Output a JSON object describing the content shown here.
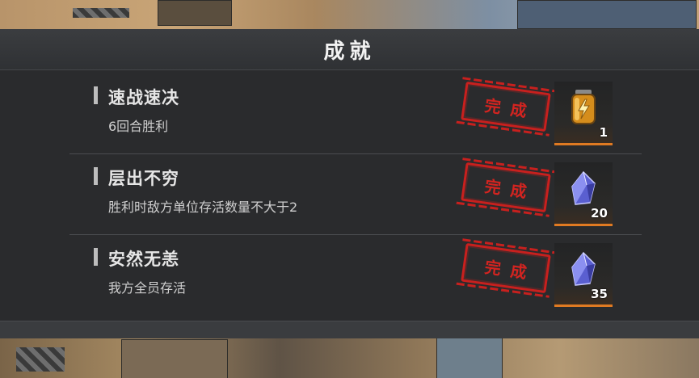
{
  "title": "成就",
  "achievements": [
    {
      "name": "速战速决",
      "description": "6回合胜利",
      "status": "完成",
      "reward_count": "1",
      "reward_icon": "energy-cell-icon"
    },
    {
      "name": "层出不穷",
      "description": "胜利时敌方单位存活数量不大于2",
      "status": "完成",
      "reward_count": "20",
      "reward_icon": "crystal-icon"
    },
    {
      "name": "安然无恙",
      "description": "我方全员存活",
      "status": "完成",
      "reward_count": "35",
      "reward_icon": "crystal-icon"
    }
  ],
  "colors": {
    "stamp": "#c8201e",
    "reward_underline": "#e07a22",
    "panel": "#2a2b2d"
  }
}
